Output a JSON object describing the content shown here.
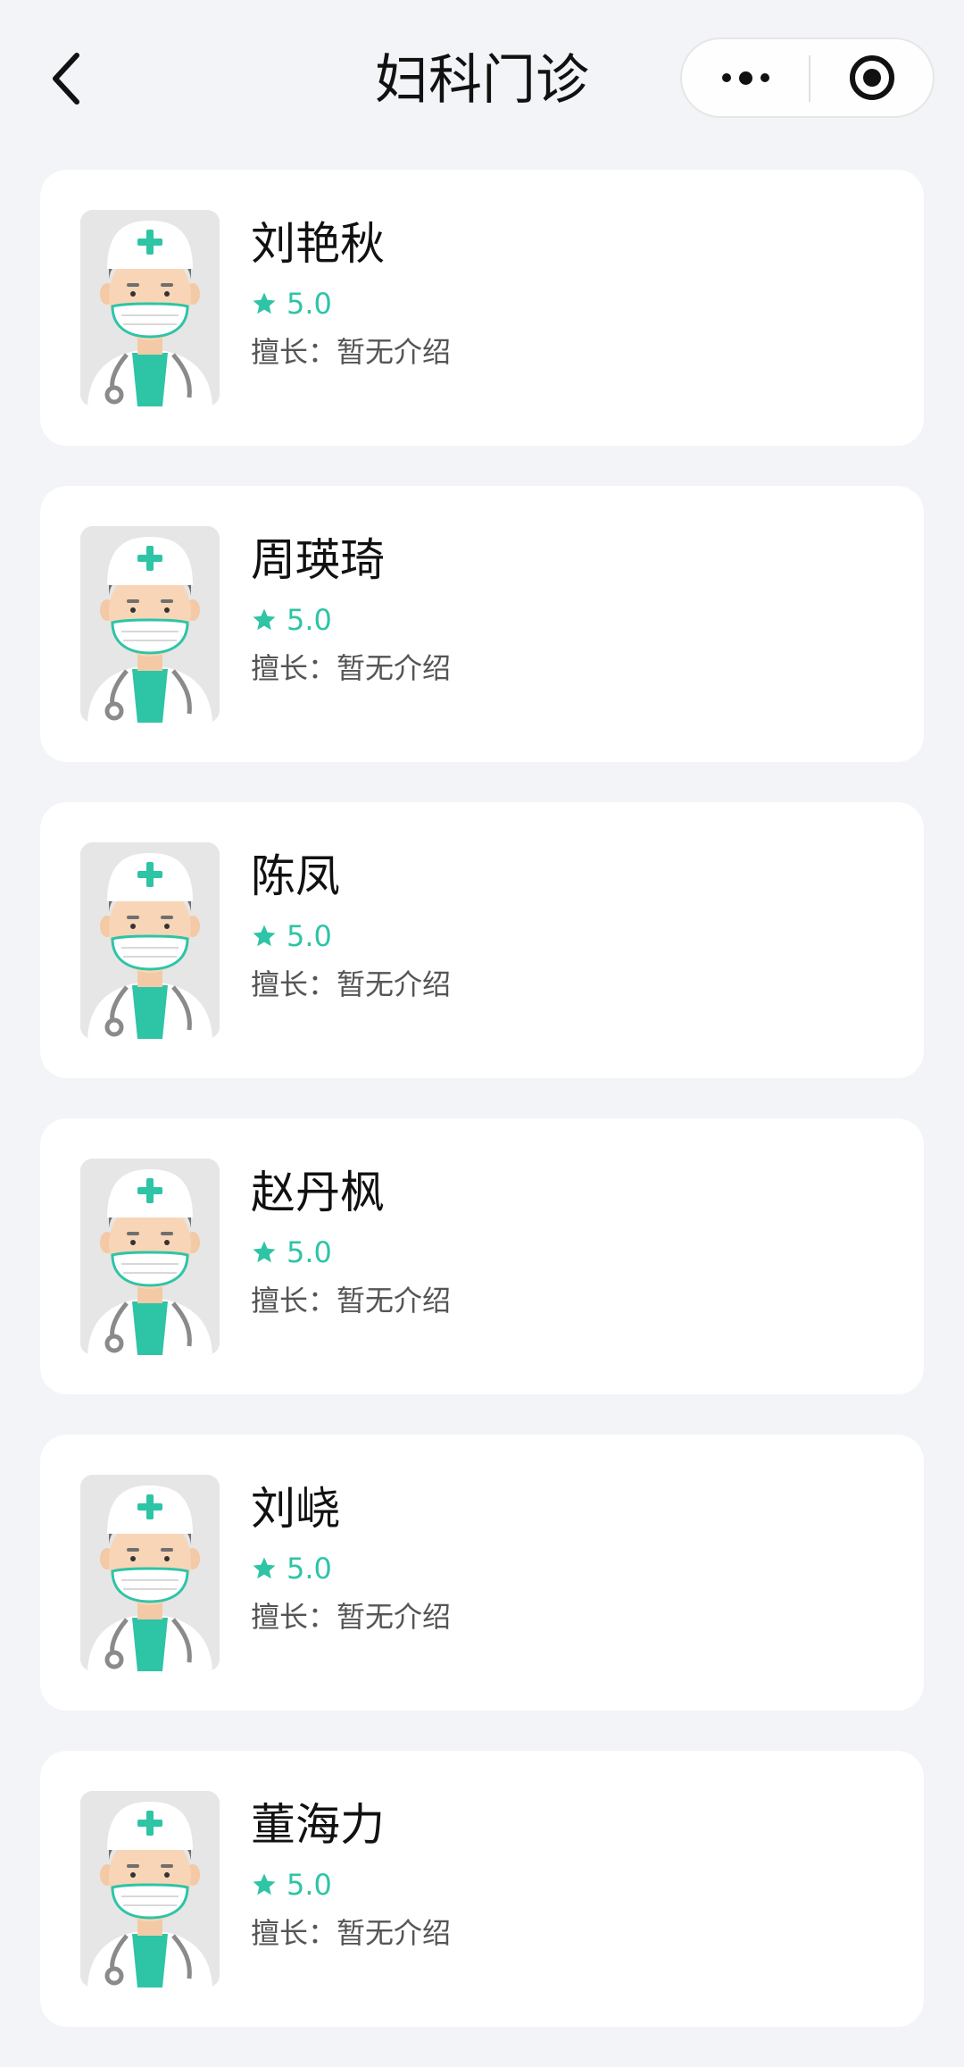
{
  "nav": {
    "title": "妇科门诊",
    "back_icon": "chevron-left-icon",
    "more_icon": "more-dots-icon",
    "close_icon": "target-close-icon"
  },
  "colors": {
    "background": "#f3f4f8",
    "card": "#ffffff",
    "accent": "#2ec4a6",
    "text_primary": "#111111",
    "text_secondary": "#555555"
  },
  "doctors": [
    {
      "name": "刘艳秋",
      "rating": "5.0",
      "specialty_label": "擅长：",
      "specialty": "暂无介绍"
    },
    {
      "name": "周瑛琦",
      "rating": "5.0",
      "specialty_label": "擅长：",
      "specialty": "暂无介绍"
    },
    {
      "name": "陈凤",
      "rating": "5.0",
      "specialty_label": "擅长：",
      "specialty": "暂无介绍"
    },
    {
      "name": "赵丹枫",
      "rating": "5.0",
      "specialty_label": "擅长：",
      "specialty": "暂无介绍"
    },
    {
      "name": "刘峣",
      "rating": "5.0",
      "specialty_label": "擅长：",
      "specialty": "暂无介绍"
    },
    {
      "name": "董海力",
      "rating": "5.0",
      "specialty_label": "擅长：",
      "specialty": "暂无介绍"
    }
  ]
}
